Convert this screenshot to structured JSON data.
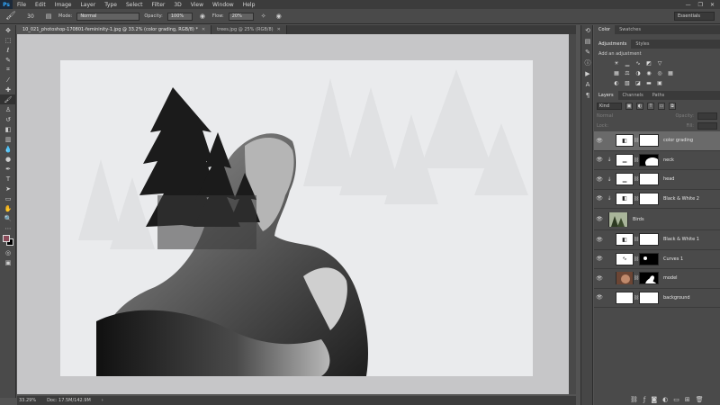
{
  "menubar": {
    "logo": "Ps",
    "items": [
      "File",
      "Edit",
      "Image",
      "Layer",
      "Type",
      "Select",
      "Filter",
      "3D",
      "View",
      "Window",
      "Help"
    ],
    "window_controls": [
      "—",
      "❐",
      "✕"
    ]
  },
  "options": {
    "tool_icon": "brush-icon",
    "brush_size": "30",
    "mode_label": "Mode:",
    "mode_value": "Normal",
    "opacity_label": "Opacity:",
    "opacity_value": "100%",
    "flow_label": "Flow:",
    "flow_value": "20%",
    "workspace": "Essentials"
  },
  "doc_tabs": [
    {
      "label": "10_021_photoshop-170801-femininity-1.jpg @ 33.2% (color grading, RGB/8) *",
      "active": true
    },
    {
      "label": "trees.jpg @ 25% (RGB/8)",
      "active": false
    }
  ],
  "status": {
    "zoom": "33.29%",
    "doc": "Doc: 17.5M/142.9M"
  },
  "panels": {
    "top_tabs": [
      "Color",
      "Swatches"
    ],
    "adj_tabs": [
      "Adjustments",
      "Styles"
    ],
    "adj_title": "Add an adjustment",
    "layer_tabs": [
      "Layers",
      "Channels",
      "Paths"
    ],
    "kind_label": "Kind",
    "blend_mode": "Normal",
    "opacity_label": "Opacity:",
    "lock_label": "Lock:",
    "fill_label": "Fill:"
  },
  "layers": [
    {
      "name": "color grading",
      "type": "adjustment",
      "selected": true
    },
    {
      "name": "neck",
      "type": "adjustment",
      "selected": false
    },
    {
      "name": "head",
      "type": "adjustment",
      "selected": false
    },
    {
      "name": "Black & White 2",
      "type": "adjustment",
      "selected": false
    },
    {
      "name": "Birds",
      "type": "image",
      "selected": false
    },
    {
      "name": "Black & White 1",
      "type": "adjustment",
      "selected": false
    },
    {
      "name": "Curves 1",
      "type": "adjustment",
      "selected": false
    },
    {
      "name": "model",
      "type": "image",
      "selected": false
    },
    {
      "name": "background",
      "type": "image",
      "selected": false
    }
  ],
  "colors": {
    "foreground": "#8a4b59",
    "background": "#000000",
    "workspace_bg": "#535353",
    "canvas_bg": "#c6c6c8"
  }
}
